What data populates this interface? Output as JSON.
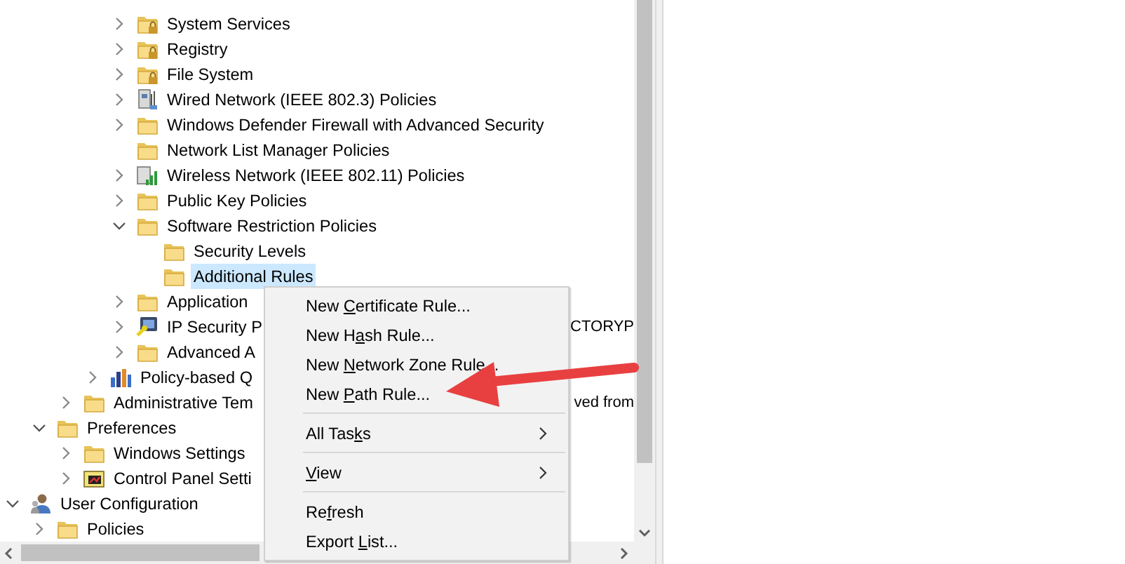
{
  "tree": [
    {
      "children": [
        {
          "children": [
            {
              "children": [
                {
                  "children": [
                    {
                      "label": "System Services",
                      "kind": "locked-folder",
                      "expandable": true,
                      "expanded": false,
                      "selected": false
                    },
                    {
                      "label": "Registry",
                      "kind": "locked-folder",
                      "expandable": true,
                      "expanded": false,
                      "selected": false
                    },
                    {
                      "label": "File System",
                      "kind": "locked-folder",
                      "expandable": true,
                      "expanded": false,
                      "selected": false
                    },
                    {
                      "label": "Wired Network (IEEE 802.3) Policies",
                      "kind": "network",
                      "expandable": true,
                      "expanded": false,
                      "selected": false
                    },
                    {
                      "label": "Windows Defender Firewall with Advanced Security",
                      "kind": "folder",
                      "expandable": true,
                      "expanded": false,
                      "selected": false
                    },
                    {
                      "label": "Network List Manager Policies",
                      "kind": "folder",
                      "expandable": false,
                      "selected": false
                    },
                    {
                      "label": "Wireless Network (IEEE 802.11) Policies",
                      "kind": "wireless",
                      "expandable": true,
                      "expanded": false,
                      "selected": false
                    },
                    {
                      "label": "Public Key Policies",
                      "kind": "folder",
                      "expandable": true,
                      "expanded": false,
                      "selected": false
                    },
                    {
                      "label": "Software Restriction Policies",
                      "kind": "folder",
                      "expandable": true,
                      "expanded": true,
                      "selected": false,
                      "children": [
                        {
                          "label": "Security Levels",
                          "kind": "folder",
                          "expandable": false,
                          "selected": false
                        },
                        {
                          "label": "Additional Rules",
                          "kind": "folder",
                          "expandable": false,
                          "selected": true
                        }
                      ]
                    },
                    {
                      "label": "Application",
                      "kind": "folder",
                      "expandable": true,
                      "expanded": false,
                      "selected": false
                    },
                    {
                      "label": "IP Security P",
                      "kind": "ip-security",
                      "expandable": true,
                      "expanded": false,
                      "selected": false,
                      "tail": "CTORYP"
                    },
                    {
                      "label": "Advanced A",
                      "kind": "folder",
                      "expandable": true,
                      "expanded": false,
                      "selected": false
                    }
                  ]
                },
                {
                  "label": "Policy-based Q",
                  "kind": "chart",
                  "expandable": true,
                  "expanded": false,
                  "selected": false
                }
              ]
            },
            {
              "label": "Administrative Tem",
              "kind": "folder",
              "expandable": true,
              "expanded": false,
              "selected": false,
              "tail": "ved from"
            }
          ]
        },
        {
          "label": "Preferences",
          "kind": "folder",
          "expandable": true,
          "expanded": true,
          "selected": false,
          "children": [
            {
              "label": "Windows Settings",
              "kind": "folder",
              "expandable": true,
              "expanded": false,
              "selected": false
            },
            {
              "label": "Control Panel Setti",
              "kind": "control-panel",
              "expandable": true,
              "expanded": false,
              "selected": false
            }
          ]
        }
      ]
    },
    {
      "label": "User Configuration",
      "kind": "user",
      "expandable": true,
      "expanded": true,
      "selected": false,
      "children": [
        {
          "label": "Policies",
          "kind": "folder",
          "expandable": true,
          "expanded": false,
          "selected": false
        }
      ]
    }
  ],
  "context_menu": [
    {
      "kind": "item",
      "text_before": "New ",
      "access_key": "C",
      "text_after": "ertificate Rule...",
      "submenu": false
    },
    {
      "kind": "item",
      "text_before": "New H",
      "access_key": "a",
      "text_after": "sh Rule...",
      "submenu": false
    },
    {
      "kind": "item",
      "text_before": "New ",
      "access_key": "N",
      "text_after": "etwork Zone Rule...",
      "submenu": false
    },
    {
      "kind": "item",
      "text_before": "New ",
      "access_key": "P",
      "text_after": "ath Rule...",
      "submenu": false
    },
    {
      "kind": "separator"
    },
    {
      "kind": "item",
      "text_before": "All Tas",
      "access_key": "k",
      "text_after": "s",
      "submenu": true
    },
    {
      "kind": "separator"
    },
    {
      "kind": "item",
      "access_key": "V",
      "text_after": "iew",
      "submenu": true
    },
    {
      "kind": "separator"
    },
    {
      "kind": "item",
      "text_before": "Re",
      "access_key": "f",
      "text_after": "resh",
      "submenu": false
    },
    {
      "kind": "item",
      "text_before": "Export ",
      "access_key": "L",
      "text_after": "ist...",
      "submenu": false
    }
  ]
}
